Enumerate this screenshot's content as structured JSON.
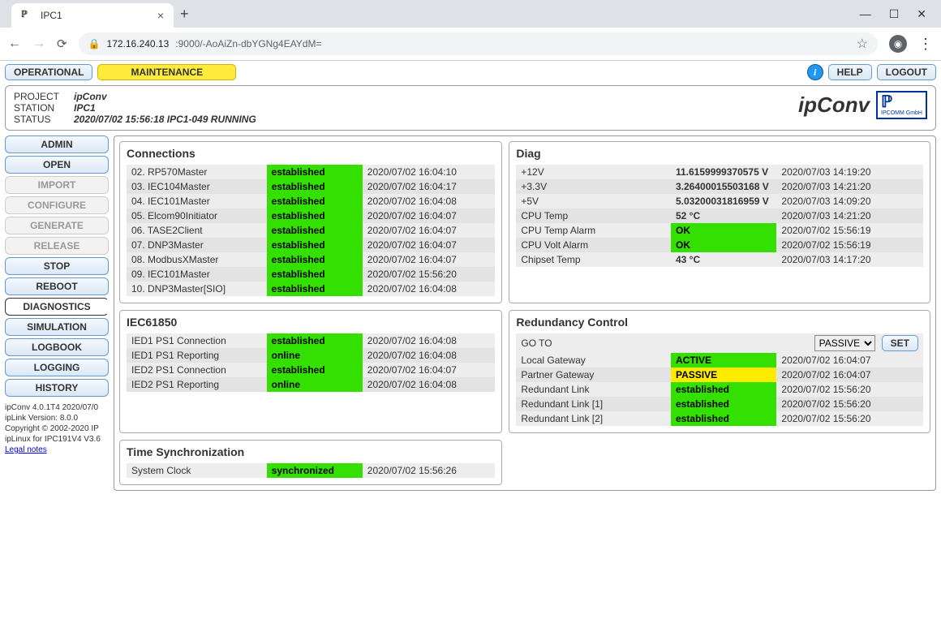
{
  "browser": {
    "tab_title": "IPC1",
    "url_host": "172.16.240.13",
    "url_port_path": ":9000/-AoAiZn-dbYGNg4EAYdM="
  },
  "topbar": {
    "operational": "OPERATIONAL",
    "maintenance": "MAINTENANCE",
    "help": "HELP",
    "logout": "LOGOUT"
  },
  "header": {
    "project_lbl": "PROJECT",
    "project_val": "ipConv",
    "station_lbl": "STATION",
    "station_val": "IPC1",
    "status_lbl": "STATUS",
    "status_val": "2020/07/02 15:56:18 IPC1-049 RUNNING",
    "brand": "ipConv",
    "brand_sub": "IPCOMM GmbH"
  },
  "sidebar": {
    "items": [
      {
        "label": "ADMIN",
        "state": "enabled"
      },
      {
        "label": "OPEN",
        "state": "enabled"
      },
      {
        "label": "IMPORT",
        "state": "disabled"
      },
      {
        "label": "CONFIGURE",
        "state": "disabled"
      },
      {
        "label": "GENERATE",
        "state": "disabled"
      },
      {
        "label": "RELEASE",
        "state": "disabled"
      },
      {
        "label": "STOP",
        "state": "enabled"
      },
      {
        "label": "REBOOT",
        "state": "enabled"
      },
      {
        "label": "DIAGNOSTICS",
        "state": "selected"
      },
      {
        "label": "SIMULATION",
        "state": "enabled"
      },
      {
        "label": "LOGBOOK",
        "state": "enabled"
      },
      {
        "label": "LOGGING",
        "state": "enabled"
      },
      {
        "label": "HISTORY",
        "state": "enabled"
      }
    ],
    "footer": [
      "ipConv 4.0.1T4 2020/07/0",
      "ipLink Version: 8.0.0",
      "Copyright © 2002-2020 IP",
      "ipLinux for IPC191V4 V3.6"
    ],
    "legal": "Legal notes"
  },
  "panels": {
    "connections": {
      "title": "Connections",
      "rows": [
        {
          "name": "02. RP570Master",
          "status": "established",
          "cls": "st-green",
          "ts": "2020/07/02 16:04:10"
        },
        {
          "name": "03. IEC104Master",
          "status": "established",
          "cls": "st-green",
          "ts": "2020/07/02 16:04:17"
        },
        {
          "name": "04. IEC101Master",
          "status": "established",
          "cls": "st-green",
          "ts": "2020/07/02 16:04:08"
        },
        {
          "name": "05. Elcom90Initiator",
          "status": "established",
          "cls": "st-green",
          "ts": "2020/07/02 16:04:07"
        },
        {
          "name": "06. TASE2Client",
          "status": "established",
          "cls": "st-green",
          "ts": "2020/07/02 16:04:07"
        },
        {
          "name": "07. DNP3Master",
          "status": "established",
          "cls": "st-green",
          "ts": "2020/07/02 16:04:07"
        },
        {
          "name": "08. ModbusXMaster",
          "status": "established",
          "cls": "st-green",
          "ts": "2020/07/02 16:04:07"
        },
        {
          "name": "09. IEC101Master",
          "status": "established",
          "cls": "st-green",
          "ts": "2020/07/02 15:56:20"
        },
        {
          "name": "10. DNP3Master[SIO]",
          "status": "established",
          "cls": "st-green",
          "ts": "2020/07/02 16:04:08"
        }
      ]
    },
    "diag": {
      "title": "Diag",
      "rows": [
        {
          "name": "+12V",
          "status": "11.6159999370575 V",
          "cls": "",
          "ts": "2020/07/03 14:19:20"
        },
        {
          "name": "+3.3V",
          "status": "3.26400015503168 V",
          "cls": "",
          "ts": "2020/07/03 14:21:20"
        },
        {
          "name": "+5V",
          "status": "5.03200031816959 V",
          "cls": "",
          "ts": "2020/07/03 14:09:20"
        },
        {
          "name": "CPU Temp",
          "status": "52 °C",
          "cls": "",
          "ts": "2020/07/03 14:21:20"
        },
        {
          "name": "CPU Temp Alarm",
          "status": "OK",
          "cls": "st-green",
          "ts": "2020/07/02 15:56:19"
        },
        {
          "name": "CPU Volt Alarm",
          "status": "OK",
          "cls": "st-green",
          "ts": "2020/07/02 15:56:19"
        },
        {
          "name": "Chipset Temp",
          "status": "43 °C",
          "cls": "",
          "ts": "2020/07/03 14:17:20"
        }
      ]
    },
    "iec61850": {
      "title": "IEC61850",
      "rows": [
        {
          "name": "IED1 PS1 Connection",
          "status": "established",
          "cls": "st-green",
          "ts": "2020/07/02 16:04:08"
        },
        {
          "name": "IED1 PS1 Reporting",
          "status": "online",
          "cls": "st-green",
          "ts": "2020/07/02 16:04:08"
        },
        {
          "name": "IED2 PS1 Connection",
          "status": "established",
          "cls": "st-green",
          "ts": "2020/07/02 16:04:07"
        },
        {
          "name": "IED2 PS1 Reporting",
          "status": "online",
          "cls": "st-green",
          "ts": "2020/07/02 16:04:08"
        }
      ]
    },
    "redundancy": {
      "title": "Redundancy Control",
      "goto_lbl": "GO TO",
      "goto_val": "PASSIVE",
      "set_lbl": "SET",
      "rows": [
        {
          "name": "Local Gateway",
          "status": "ACTIVE",
          "cls": "st-green",
          "ts": "2020/07/02 16:04:07"
        },
        {
          "name": "Partner Gateway",
          "status": "PASSIVE",
          "cls": "st-yellow",
          "ts": "2020/07/02 16:04:07"
        },
        {
          "name": "Redundant Link",
          "status": "established",
          "cls": "st-green",
          "ts": "2020/07/02 15:56:20"
        },
        {
          "name": "Redundant Link [1]",
          "status": "established",
          "cls": "st-green",
          "ts": "2020/07/02 15:56:20"
        },
        {
          "name": "Redundant Link [2]",
          "status": "established",
          "cls": "st-green",
          "ts": "2020/07/02 15:56:20"
        }
      ]
    },
    "timesync": {
      "title": "Time Synchronization",
      "rows": [
        {
          "name": "System Clock",
          "status": "synchronized",
          "cls": "st-green",
          "ts": "2020/07/02 15:56:26"
        }
      ]
    }
  }
}
